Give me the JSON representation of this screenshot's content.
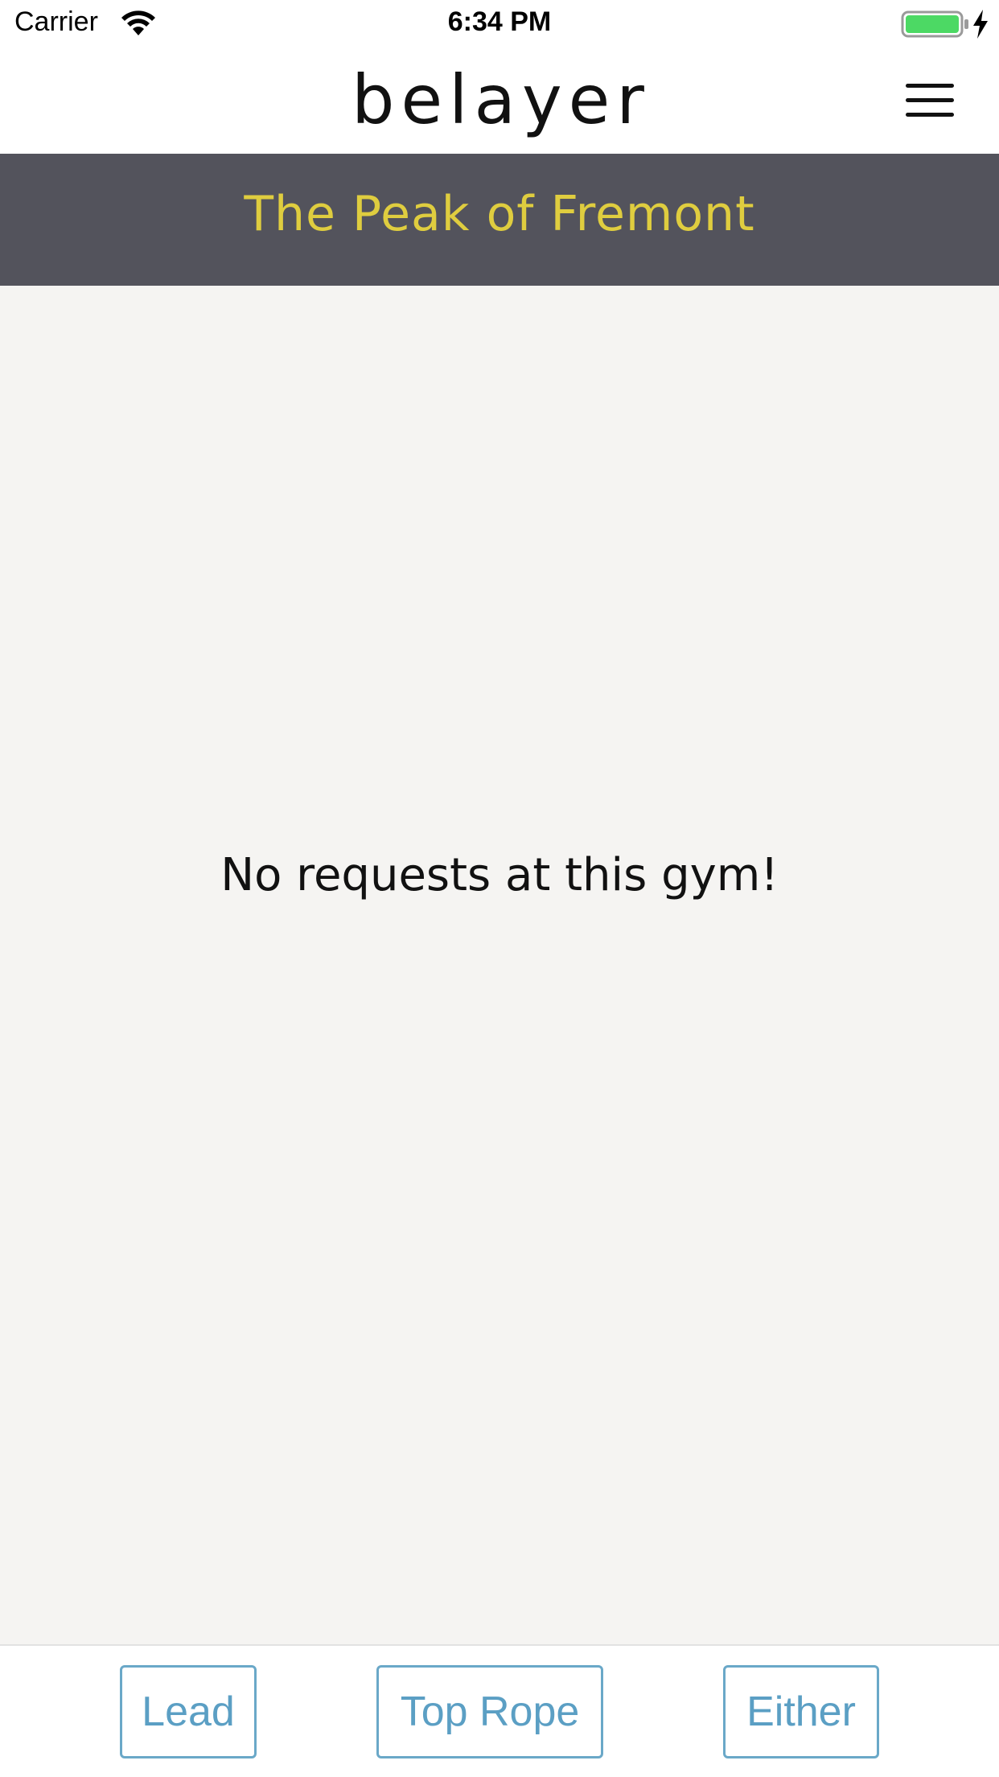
{
  "status_bar": {
    "carrier": "Carrier",
    "time": "6:34 PM",
    "wifi_icon": "wifi-icon",
    "battery_icon": "battery-icon",
    "charging_icon": "charging-bolt-icon",
    "battery_color": "#4cd964"
  },
  "header": {
    "logo_text": "belayer",
    "logo_icon": "carabiner-icon",
    "menu_icon": "hamburger-menu-icon"
  },
  "banner": {
    "title": "The Peak of Fremont",
    "background_color": "#53535c",
    "title_color": "#dfcd3f"
  },
  "content": {
    "empty_message": "No requests at this gym!",
    "background_color": "#f5f4f2"
  },
  "actions": {
    "lead_label": "Lead",
    "top_rope_label": "Top Rope",
    "either_label": "Either",
    "accent_color": "#5b9fc4"
  }
}
